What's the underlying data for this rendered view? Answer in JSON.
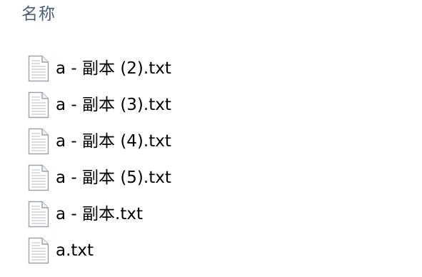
{
  "header": {
    "name_column_label": "名称"
  },
  "files": [
    {
      "name": "a - 副本 (2).txt",
      "icon": "text-file-icon"
    },
    {
      "name": "a - 副本 (3).txt",
      "icon": "text-file-icon"
    },
    {
      "name": "a - 副本 (4).txt",
      "icon": "text-file-icon"
    },
    {
      "name": "a - 副本 (5).txt",
      "icon": "text-file-icon"
    },
    {
      "name": "a - 副本.txt",
      "icon": "text-file-icon"
    },
    {
      "name": "a.txt",
      "icon": "text-file-icon"
    }
  ],
  "colors": {
    "header_text": "#4c607a",
    "file_text": "#000000",
    "icon_border": "#9aa3ad"
  }
}
